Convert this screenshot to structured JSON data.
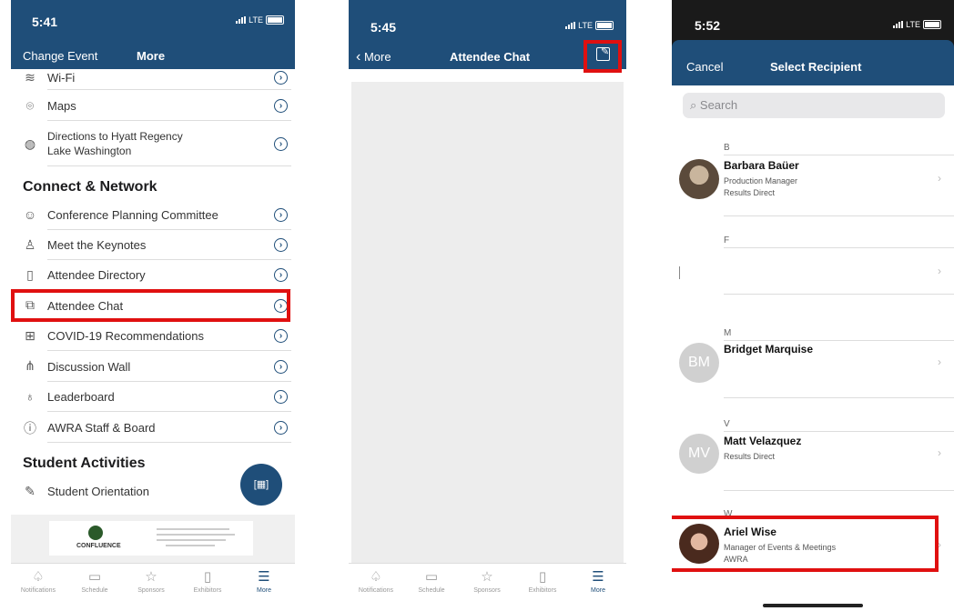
{
  "screen1": {
    "time": "5:41",
    "carrier": "LTE",
    "nav": {
      "left": "Change Event",
      "title": "More"
    },
    "rows_top": [
      {
        "label": "Wi-Fi",
        "icon": "wifi-icon"
      },
      {
        "label": "Maps",
        "icon": "map-pin-icon"
      },
      {
        "label": "Directions to Hyatt Regency",
        "label2": "Lake Washington",
        "icon": "globe-icon"
      }
    ],
    "section_connect": "Connect & Network",
    "connect_rows": [
      {
        "label": "Conference Planning Committee",
        "icon": "people-icon"
      },
      {
        "label": "Meet the Keynotes",
        "icon": "speaker-icon"
      },
      {
        "label": "Attendee Directory",
        "icon": "book-icon"
      },
      {
        "label": "Attendee Chat",
        "icon": "chat-icon"
      },
      {
        "label": "COVID-19 Recommendations",
        "icon": "medical-kit-icon"
      },
      {
        "label": "Discussion Wall",
        "icon": "network-icon"
      },
      {
        "label": "Leaderboard",
        "icon": "medal-icon"
      },
      {
        "label": "AWRA Staff & Board",
        "icon": "info-icon"
      }
    ],
    "section_student": "Student Activities",
    "student_rows": [
      {
        "label": "Student Orientation",
        "icon": "pencil-icon"
      }
    ],
    "banner": {
      "brand": "CONFLUENCE"
    },
    "fab_icon": "qr-scan-icon"
  },
  "tabs": [
    {
      "label": "Notifications",
      "icon": "bell-icon",
      "glyph": "♤"
    },
    {
      "label": "Schedule",
      "icon": "calendar-icon",
      "glyph": "▭"
    },
    {
      "label": "Sponsors",
      "icon": "star-icon",
      "glyph": "☆"
    },
    {
      "label": "Exhibitors",
      "icon": "document-icon",
      "glyph": "▯"
    },
    {
      "label": "More",
      "icon": "menu-icon",
      "glyph": "☰"
    }
  ],
  "screen2": {
    "time": "5:45",
    "carrier": "LTE",
    "nav": {
      "back": "More",
      "title": "Attendee Chat"
    }
  },
  "screen3": {
    "time": "5:52",
    "carrier": "LTE",
    "nav": {
      "cancel": "Cancel",
      "title": "Select Recipient"
    },
    "search_placeholder": "Search",
    "contacts": [
      {
        "letter": "B",
        "name": "Barbara Baüer",
        "sub1": "Production Manager",
        "sub2": "Results Direct",
        "initials": ""
      },
      {
        "letter": "F",
        "name": "",
        "sub1": "",
        "sub2": "",
        "initials": ""
      },
      {
        "letter": "M",
        "name": "Bridget Marquise",
        "sub1": "",
        "sub2": "",
        "initials": "BM"
      },
      {
        "letter": "V",
        "name": "Matt Velazquez",
        "sub1": "Results Direct",
        "sub2": "",
        "initials": "MV"
      },
      {
        "letter": "W",
        "name": "Ariel Wise",
        "sub1": "Manager of Events & Meetings",
        "sub2": "AWRA",
        "initials": ""
      }
    ]
  },
  "colors": {
    "nav": "#1f4e79",
    "highlight": "#e01010"
  }
}
